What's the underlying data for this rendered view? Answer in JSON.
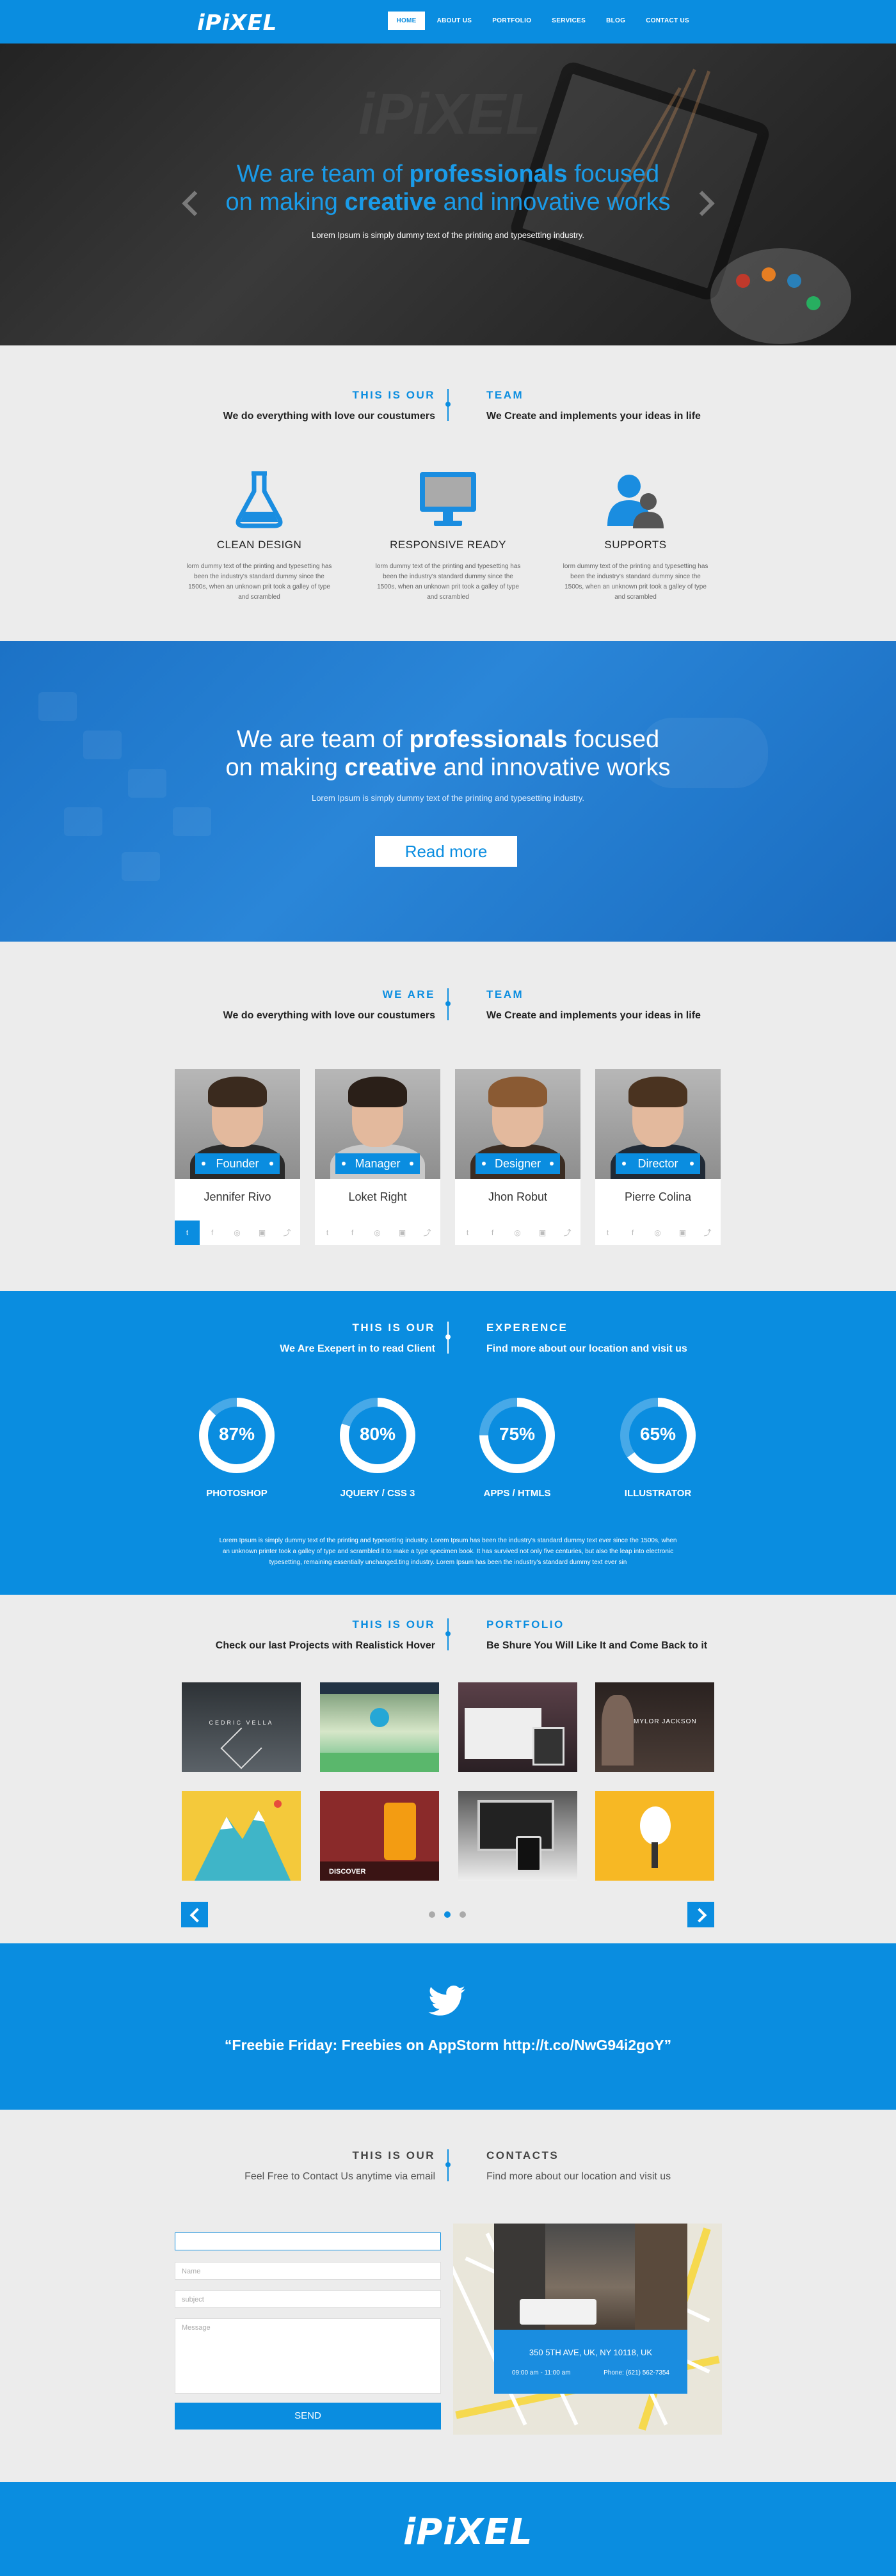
{
  "header": {
    "logo": "iPiXEL",
    "nav": [
      "HOME",
      "ABOUT US",
      "PORTFOLIO",
      "SERVICES",
      "BLOG",
      "CONTACT US"
    ]
  },
  "hero": {
    "line1_pre": "We are team of ",
    "line1_bold": "professionals",
    "line1_post": " focused",
    "line2_pre": "on making ",
    "line2_bold": "creative",
    "line2_post": " and innovative works",
    "subtitle": "Lorem Ipsum is simply dummy text of the printing and typesetting industry."
  },
  "about": {
    "left_cap": "THIS IS OUR",
    "left_sub": "We do everything with love our coustumers",
    "right_cap": "TEAM",
    "right_sub": "We Create and implements your ideas in life",
    "features": [
      {
        "title": "CLEAN DESIGN",
        "text": "lorm dummy text of the printing and typesetting has been the industry's standard dummy since the 1500s, when an unknown prit took a galley of type and scrambled",
        "icon": "flask-icon"
      },
      {
        "title": "RESPONSIVE READY",
        "text": "lorm dummy text of the printing and typesetting has been the industry's standard dummy since the 1500s, when an unknown prit took a galley of type and scrambled",
        "icon": "monitor-icon"
      },
      {
        "title": "SUPPORTS",
        "text": "lorm dummy text of the printing and typesetting has been the industry's standard dummy since the 1500s, when an unknown prit took a galley of type and scrambled",
        "icon": "users-icon"
      }
    ]
  },
  "banner": {
    "line1_pre": "We are team of ",
    "line1_bold": "professionals",
    "line1_post": " focused",
    "line2_pre": "on making ",
    "line2_bold": "creative",
    "line2_post": " and innovative works",
    "subtitle": "Lorem Ipsum is simply dummy text of the printing and typesetting industry.",
    "button": "Read more"
  },
  "team": {
    "left_cap": "WE ARE",
    "left_sub": "We do everything with love our coustumers",
    "right_cap": "TEAM",
    "right_sub": "We Create and implements your ideas in life",
    "members": [
      {
        "role": "Founder",
        "name": "Jennifer Rivo"
      },
      {
        "role": "Manager",
        "name": "Loket Right"
      },
      {
        "role": "Designer",
        "name": "Jhon Robut"
      },
      {
        "role": "Director",
        "name": "Pierre Colina"
      }
    ]
  },
  "experience": {
    "left_cap": "THIS IS OUR",
    "left_sub": "We Are Exepert in to read  Client",
    "right_cap": "EXPERENCE",
    "right_sub": "Find more about our location and visit us",
    "skills": [
      {
        "value": 87,
        "label_value": "87%",
        "label": "PHOTOSHOP"
      },
      {
        "value": 80,
        "label_value": "80%",
        "label": "JQUERY / CSS 3"
      },
      {
        "value": 75,
        "label_value": "75%",
        "label": "APPS / HTMLS"
      },
      {
        "value": 65,
        "label_value": "65%",
        "label": "ILLUSTRATOR"
      }
    ],
    "text": "Lorem Ipsum is simply dummy text of the printing and typesetting industry. Lorem Ipsum has been the industry's standard dummy text ever since the 1500s, when an unknown printer took a galley of type and scrambled it to make a type specimen book. It has survived not only five centuries, but also the leap into electronic typesetting, remaining essentially unchanged.ting industry. Lorem Ipsum has been the industry's standard dummy text ever sin"
  },
  "portfolio": {
    "left_cap": "THIS IS OUR",
    "left_sub": "Check our last Projects with Realistick Hover",
    "right_cap": "PORTFOLIO",
    "right_sub": "Be Shure You Will Like It and Come Back to it",
    "thumb_texts": [
      "CEDRIC VELLA",
      "MYLOR JACKSON",
      "DISCOVER"
    ],
    "page_count": 3,
    "active_page": 2
  },
  "tweet": {
    "text": "“Freebie Friday: Freebies on AppStorm http://t.co/NwG94i2goY”"
  },
  "contact": {
    "left_cap": "THIS IS OUR",
    "left_sub": "Feel Free to Contact Us anytime via email",
    "right_cap": "CONTACTS",
    "right_sub": "Find more about our location and visit us",
    "fields": {
      "name": "Name",
      "subject": "subject",
      "message": "Message"
    },
    "send": "SEND",
    "address": "350 5TH AVE, UK, NY 10118, UK",
    "hours": "09:00 am - 11:00 am",
    "phone": "Phone: (621) 562-7354"
  },
  "footer": {
    "logo": "iPiXEL"
  },
  "colors": {
    "accent": "#0a8de0",
    "dark_hero": "#2b2b2b",
    "background": "#ececec"
  }
}
